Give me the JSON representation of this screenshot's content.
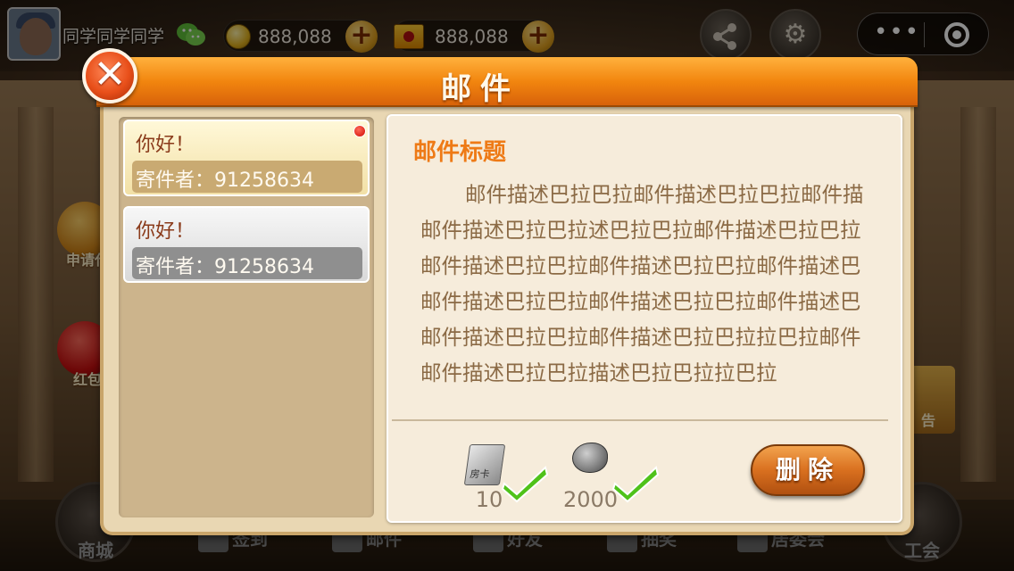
{
  "topbar": {
    "player_name": "同学同学同学",
    "gold": "888,088",
    "cards": "888,088",
    "gold_icon": "gold-coin-icon",
    "card_icon": "room-card-icon"
  },
  "lobby": {
    "side_items": [
      "申请代",
      "红包"
    ],
    "right_item": "告",
    "nav": [
      "商城",
      "签到",
      "邮件",
      "好友",
      "抽奖",
      "居委会",
      "工会"
    ]
  },
  "dialog": {
    "title": "邮件",
    "close_icon": "close-icon",
    "mails": [
      {
        "subject": "你好！",
        "sender": "寄件者：91258634",
        "unread": true
      },
      {
        "subject": "你好！",
        "sender": "寄件者：91258634",
        "unread": false
      }
    ],
    "detail": {
      "title": "邮件标题",
      "body": "邮件描述巴拉巴拉邮件描述巴拉巴拉邮件描邮件描述巴拉巴拉述巴拉巴拉邮件描述巴拉巴拉邮件描述巴拉巴拉邮件描述巴拉巴拉邮件描述巴邮件描述巴拉巴拉邮件描述巴拉巴拉邮件描述巴邮件描述巴拉巴拉邮件描述巴拉巴拉拉巴拉邮件邮件描述巴拉巴拉描述巴拉巴拉拉巴拉",
      "attachments": [
        {
          "icon": "room-card-icon",
          "count": "10",
          "claimed": true
        },
        {
          "icon": "bean-icon",
          "count": "2000",
          "claimed": true
        }
      ],
      "delete_label": "删除"
    }
  },
  "colors": {
    "header": "#f2860f",
    "title_text": "#ee7a16",
    "body_text": "#8b6a45",
    "check": "#4fc21a"
  }
}
